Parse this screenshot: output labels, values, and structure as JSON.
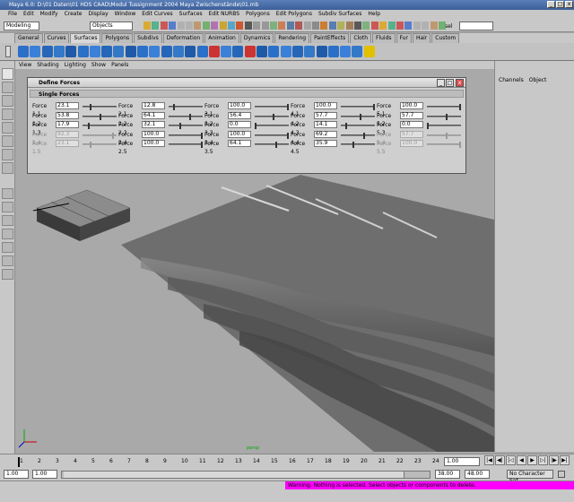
{
  "window": {
    "title": "Maya 6.0: D:\\01 Daten\\01 HDS CAAD\\Modul Tussignment 2004 Maya Zwischenstände\\01.mb"
  },
  "menubar": [
    "File",
    "Edit",
    "Modify",
    "Create",
    "Display",
    "Window",
    "Edit Curves",
    "Surfaces",
    "Edit NURBS",
    "Polygons",
    "Edit Polygons",
    "Subdiv Surfaces",
    "Help"
  ],
  "statusline": {
    "menuset": "Modeling",
    "selection_mode": "Objects",
    "sel_label": "sel",
    "input_value": ""
  },
  "shelf_tabs": [
    "General",
    "Curves",
    "Surfaces",
    "Polygons",
    "Subdivs",
    "Deformation",
    "Animation",
    "Dynamics",
    "Rendering",
    "PaintEffects",
    "Cloth",
    "Fluids",
    "Fur",
    "Hair",
    "Custom"
  ],
  "shelf_active": "Surfaces",
  "viewport_menu": [
    "View",
    "Shading",
    "Lighting",
    "Show",
    "Panels"
  ],
  "camera_label": "persp",
  "channel_box": {
    "tabs": [
      "Channels",
      "Object"
    ]
  },
  "dialog": {
    "title": "Define Forces",
    "section": "Single Forces",
    "columns": [
      {
        "rows": [
          {
            "label": "Force 1.1",
            "value": "23.1",
            "level": 0.23,
            "enabled": true
          },
          {
            "label": "Force 1.2",
            "value": "53.8",
            "level": 0.54,
            "enabled": true
          },
          {
            "label": "Force 1.3",
            "value": "17.9",
            "level": 0.18,
            "enabled": true
          },
          {
            "label": "Force 1.4",
            "value": "92.3",
            "level": 0.92,
            "enabled": false
          },
          {
            "label": "Force 1.5",
            "value": "23.1",
            "level": 0.23,
            "enabled": false
          }
        ]
      },
      {
        "rows": [
          {
            "label": "Force 2.1",
            "value": "12.8",
            "level": 0.13,
            "enabled": true
          },
          {
            "label": "Force 2.2",
            "value": "64.1",
            "level": 0.64,
            "enabled": true
          },
          {
            "label": "Force 2.3",
            "value": "32.1",
            "level": 0.32,
            "enabled": true
          },
          {
            "label": "Force 2.4",
            "value": "100.0",
            "level": 1.0,
            "enabled": true
          },
          {
            "label": "Force 2.5",
            "value": "100.0",
            "level": 1.0,
            "enabled": true
          }
        ]
      },
      {
        "rows": [
          {
            "label": "Force 3.1",
            "value": "100.0",
            "level": 1.0,
            "enabled": true
          },
          {
            "label": "Force 3.2",
            "value": "56.4",
            "level": 0.56,
            "enabled": true
          },
          {
            "label": "Force 3.3",
            "value": "0.0",
            "level": 0.0,
            "enabled": true
          },
          {
            "label": "Force 3.4",
            "value": "100.0",
            "level": 1.0,
            "enabled": true
          },
          {
            "label": "Force 3.5",
            "value": "64.1",
            "level": 0.64,
            "enabled": true
          }
        ]
      },
      {
        "rows": [
          {
            "label": "Force 4.1",
            "value": "100.0",
            "level": 1.0,
            "enabled": true
          },
          {
            "label": "Force 4.2",
            "value": "57.7",
            "level": 0.58,
            "enabled": true
          },
          {
            "label": "Force 4.3",
            "value": "14.1",
            "level": 0.14,
            "enabled": true
          },
          {
            "label": "Force 4.4",
            "value": "69.2",
            "level": 0.69,
            "enabled": true
          },
          {
            "label": "Force 4.5",
            "value": "35.9",
            "level": 0.36,
            "enabled": true
          }
        ]
      },
      {
        "rows": [
          {
            "label": "Force 5.1",
            "value": "100.0",
            "level": 1.0,
            "enabled": true
          },
          {
            "label": "Force 5.2",
            "value": "57.7",
            "level": 0.58,
            "enabled": true
          },
          {
            "label": "Force 5.3",
            "value": "0.0",
            "level": 0.0,
            "enabled": true
          },
          {
            "label": "Force 5.4",
            "value": "57.7",
            "level": 0.58,
            "enabled": false
          },
          {
            "label": "Force 5.5",
            "value": "100.0",
            "level": 1.0,
            "enabled": false
          }
        ]
      }
    ]
  },
  "timeline": {
    "ticks": [
      "1",
      "2",
      "3",
      "4",
      "5",
      "6",
      "7",
      "8",
      "9",
      "10",
      "11",
      "12",
      "13",
      "14",
      "15",
      "16",
      "17",
      "18",
      "19",
      "20",
      "21",
      "22",
      "23",
      "24"
    ],
    "current_frame": "1.00"
  },
  "range": {
    "start": "1.00",
    "inner_start": "1.00",
    "inner_end": "38.00",
    "end": "48.00",
    "character_set": "No Character Set"
  },
  "feedback": "Warning: Nothing is selected. Select objects or components to delete.",
  "colors": {
    "feedback_bg": "#ff00ff",
    "titlebar": "#3c5f99",
    "surface": "#6e6e6e"
  }
}
